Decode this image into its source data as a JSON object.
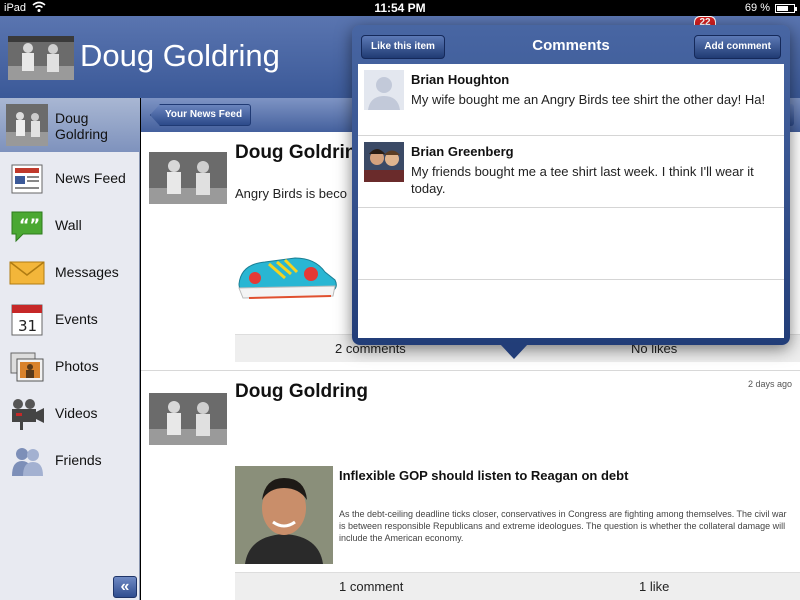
{
  "status_bar": {
    "carrier": "iPad",
    "time": "11:54 PM",
    "battery": "69 %",
    "battery_level": 0.69
  },
  "header": {
    "title": "Doug Goldring",
    "notification_count": "22"
  },
  "sidebar": {
    "profile": "Doug Goldring",
    "items": [
      {
        "label": "News Feed",
        "icon": "news-feed-icon"
      },
      {
        "label": "Wall",
        "icon": "wall-icon"
      },
      {
        "label": "Messages",
        "icon": "messages-icon"
      },
      {
        "label": "Events",
        "icon": "events-icon",
        "icon_text": "31"
      },
      {
        "label": "Photos",
        "icon": "photos-icon"
      },
      {
        "label": "Videos",
        "icon": "videos-icon"
      },
      {
        "label": "Friends",
        "icon": "friends-icon"
      }
    ],
    "collapse_label": "«"
  },
  "feed": {
    "back_label": "Your News Feed",
    "posts": [
      {
        "author": "Doug Goldring",
        "text": "Angry Birds is beco",
        "comments_label": "2 comments",
        "likes_label": "No likes"
      },
      {
        "author": "Doug Goldring",
        "time": "2 days ago",
        "link_title": "Inflexible GOP should listen to Reagan on debt",
        "link_desc": "As the debt-ceiling deadline ticks closer, conservatives in Congress are fighting among themselves. The civil war is between responsible Republicans and extreme ideologues. The question is whether the collateral damage will include the American economy.",
        "comments_label": "1 comment",
        "likes_label": "1 like"
      }
    ]
  },
  "popover": {
    "title": "Comments",
    "like_label": "Like this item",
    "add_label": "Add comment",
    "comments": [
      {
        "name": "Brian Houghton",
        "text": "My wife bought me an Angry Birds tee shirt the other day! Ha!"
      },
      {
        "name": "Brian Greenberg",
        "text": "My friends bought me a tee shirt last week.  I think I'll wear it today."
      }
    ]
  }
}
